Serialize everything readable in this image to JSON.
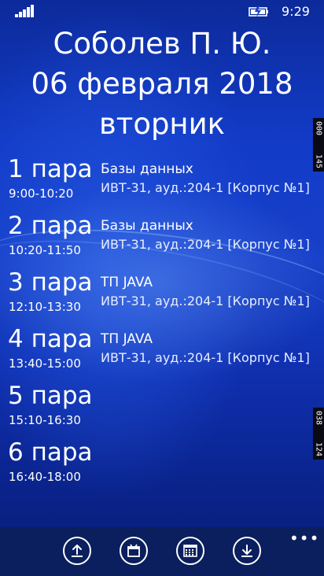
{
  "status_bar": {
    "signal_icon": "signal-bars-icon",
    "battery_icon": "battery-charging-icon",
    "time": "9:29"
  },
  "header": {
    "name": "Соболев П. Ю.",
    "date": "06 февраля 2018",
    "weekday": "вторник"
  },
  "side_badges": {
    "top": [
      "000",
      "145"
    ],
    "bottom": [
      "038",
      "124"
    ]
  },
  "lessons": [
    {
      "pair": "1 пара",
      "time": "9:00-10:20",
      "subject": "Базы данных",
      "group": "ИВТ-31, ауд.:204-1 [Корпус №1]"
    },
    {
      "pair": "2 пара",
      "time": "10:20-11:50",
      "subject": "Базы данных",
      "group": "ИВТ-31, ауд.:204-1 [Корпус №1]"
    },
    {
      "pair": "3 пара",
      "time": "12:10-13:30",
      "subject": "ТП JAVA",
      "group": "ИВТ-31, ауд.:204-1 [Корпус №1]"
    },
    {
      "pair": "4 пара",
      "time": "13:40-15:00",
      "subject": "ТП JAVA",
      "group": "ИВТ-31, ауд.:204-1 [Корпус №1]"
    },
    {
      "pair": "5 пара",
      "time": "15:10-16:30",
      "subject": "",
      "group": ""
    },
    {
      "pair": "6 пара",
      "time": "16:40-18:00",
      "subject": "",
      "group": ""
    }
  ],
  "app_bar": {
    "buttons": [
      "upload-icon",
      "calendar-day-icon",
      "calendar-month-icon",
      "download-icon"
    ],
    "more": "•••"
  }
}
